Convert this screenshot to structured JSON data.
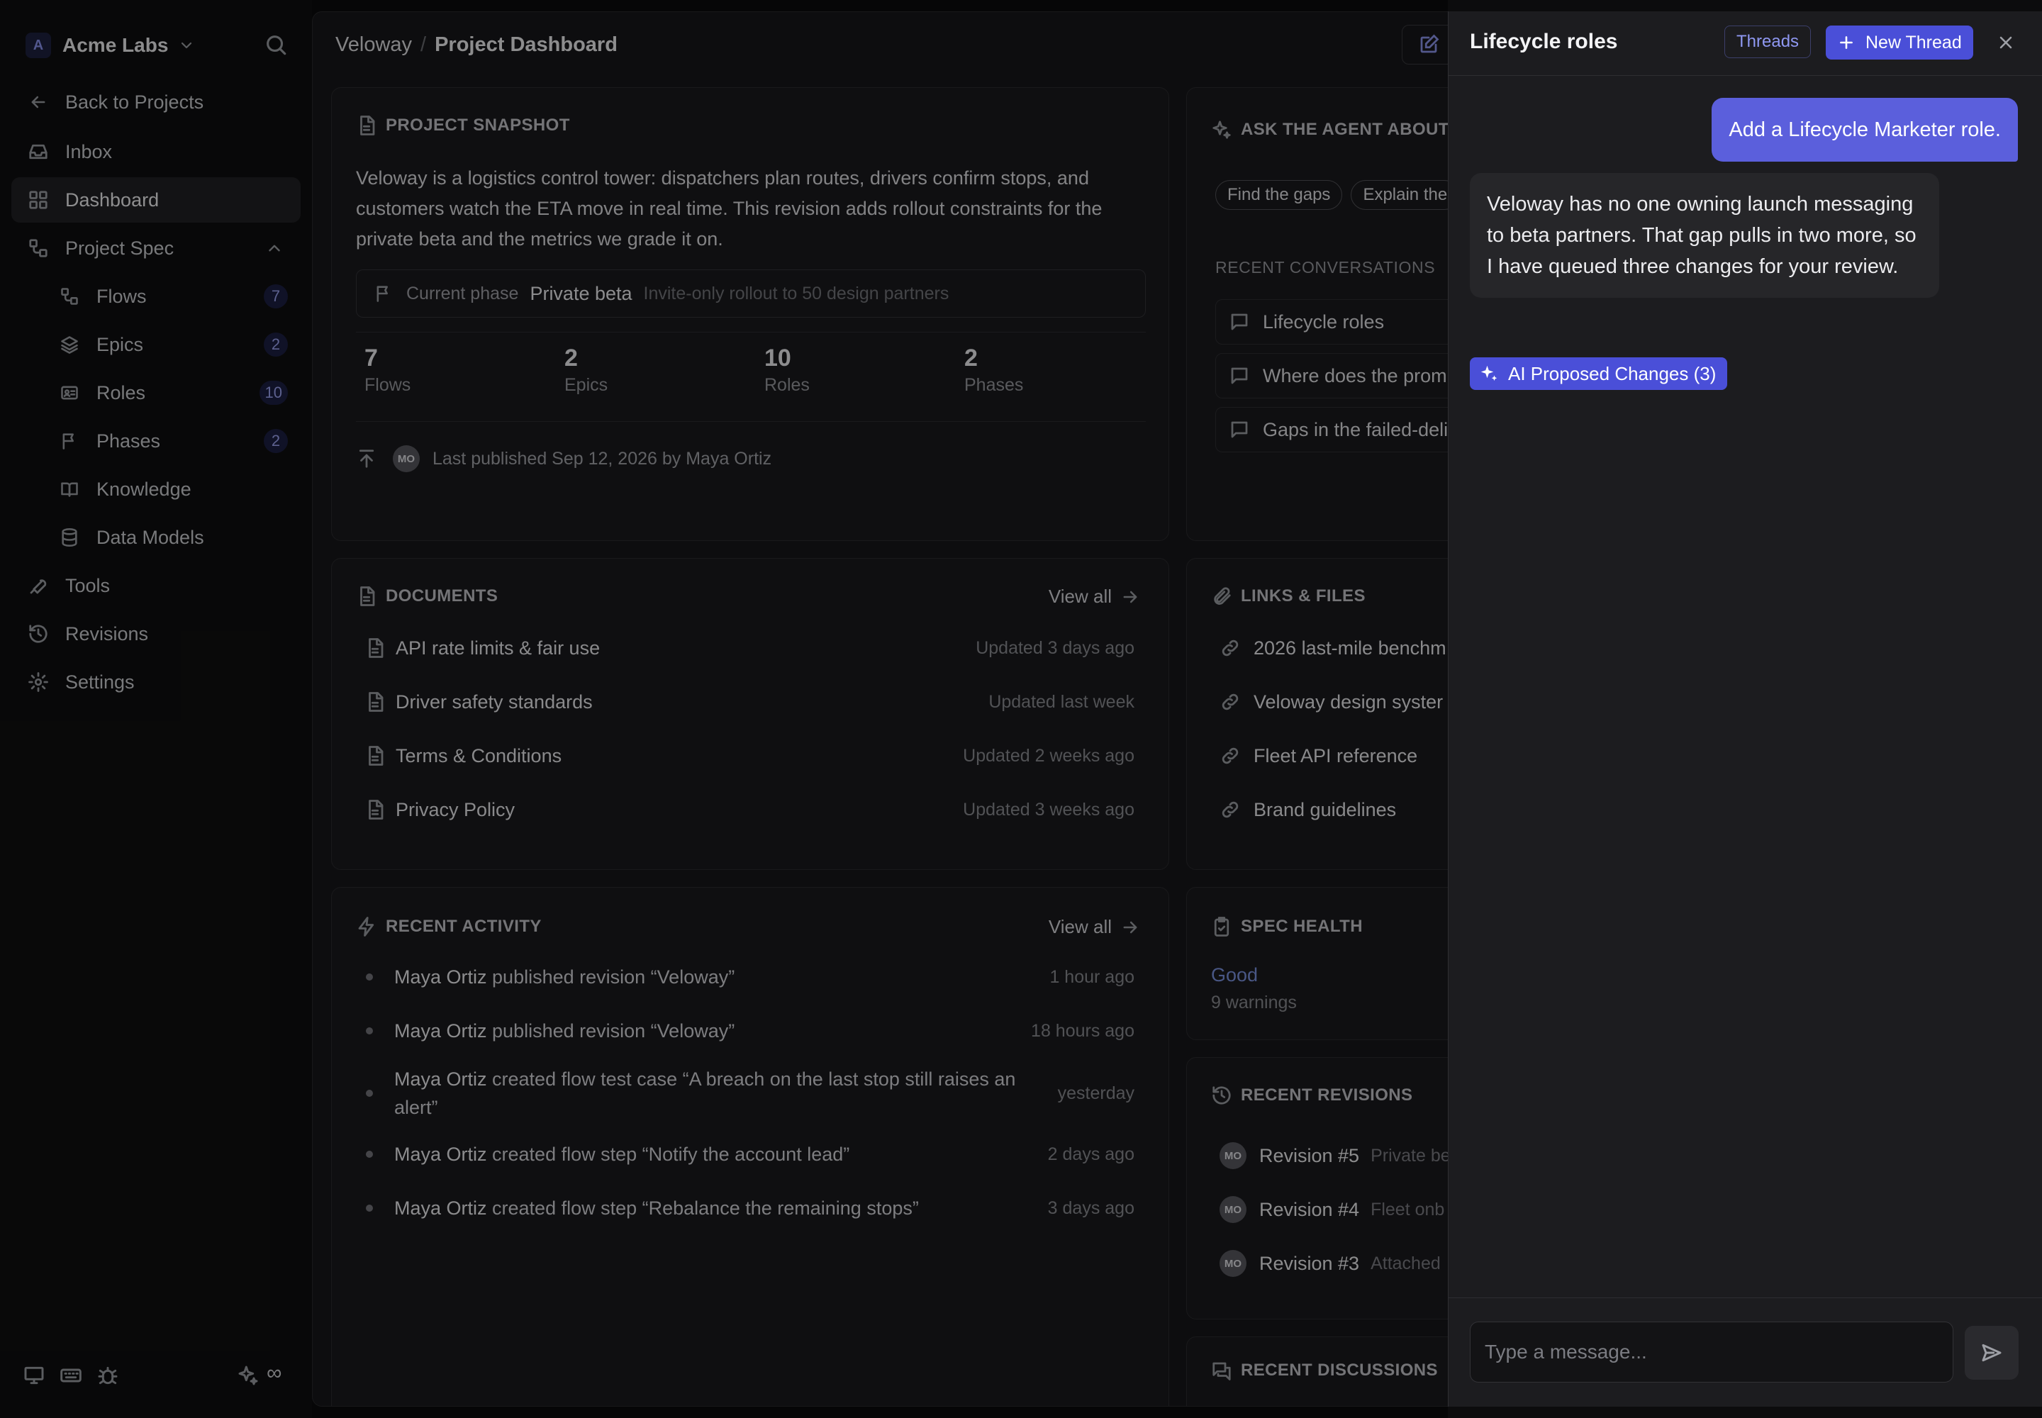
{
  "sidebar": {
    "org_initial": "A",
    "org_name": "Acme Labs",
    "items": [
      {
        "label": "Back to Projects"
      },
      {
        "label": "Inbox"
      },
      {
        "label": "Dashboard"
      },
      {
        "label": "Project Spec"
      },
      {
        "label": "Flows",
        "count": "7"
      },
      {
        "label": "Epics",
        "count": "2"
      },
      {
        "label": "Roles",
        "count": "10"
      },
      {
        "label": "Phases",
        "count": "2"
      },
      {
        "label": "Knowledge"
      },
      {
        "label": "Data Models"
      },
      {
        "label": "Tools"
      },
      {
        "label": "Revisions"
      },
      {
        "label": "Settings"
      }
    ],
    "footer_infinity": "∞"
  },
  "header": {
    "project": "Veloway",
    "separator": "/",
    "page": "Project Dashboard"
  },
  "snapshot": {
    "title": "PROJECT SNAPSHOT",
    "description": "Veloway is a logistics control tower: dispatchers plan routes, drivers confirm stops, and customers watch the ETA move in real time. This revision adds rollout constraints for the private beta and the metrics we grade it on.",
    "phase_label": "Current phase",
    "phase_value": "Private beta",
    "phase_note": "Invite-only rollout to 50 design partners",
    "stats": [
      {
        "value": "7",
        "label": "Flows"
      },
      {
        "value": "2",
        "label": "Epics"
      },
      {
        "value": "10",
        "label": "Roles"
      },
      {
        "value": "2",
        "label": "Phases"
      }
    ],
    "avatar_initials": "MO",
    "published": "Last published Sep 12, 2026 by Maya Ortiz"
  },
  "agent": {
    "title": "ASK THE AGENT ABOUT",
    "chips": [
      "Find the gaps",
      "Explain the"
    ],
    "recent_title": "RECENT CONVERSATIONS",
    "conversations": [
      "Lifecycle roles",
      "Where does the prom",
      "Gaps in the failed-deli"
    ]
  },
  "documents": {
    "title": "DOCUMENTS",
    "view_all": "View all",
    "rows": [
      {
        "name": "API rate limits & fair use",
        "meta": "Updated 3 days ago"
      },
      {
        "name": "Driver safety standards",
        "meta": "Updated last week"
      },
      {
        "name": "Terms & Conditions",
        "meta": "Updated 2 weeks ago"
      },
      {
        "name": "Privacy Policy",
        "meta": "Updated 3 weeks ago"
      }
    ]
  },
  "links": {
    "title": "LINKS & FILES",
    "rows": [
      "2026 last-mile benchm",
      "Veloway design syster",
      "Fleet API reference",
      "Brand guidelines"
    ]
  },
  "activity": {
    "title": "RECENT ACTIVITY",
    "view_all": "View all",
    "rows": [
      {
        "who": "Maya Ortiz",
        "what": " published revision “Veloway”",
        "when": "1 hour ago"
      },
      {
        "who": "Maya Ortiz",
        "what": " published revision “Veloway”",
        "when": "18 hours ago"
      },
      {
        "who": "Maya Ortiz",
        "what": " created flow test case “A breach on the last stop still raises an alert”",
        "when": "yesterday"
      },
      {
        "who": "Maya Ortiz",
        "what": " created flow step “Notify the account lead”",
        "when": "2 days ago"
      },
      {
        "who": "Maya Ortiz",
        "what": " created flow step “Rebalance the remaining stops”",
        "when": "3 days ago"
      }
    ]
  },
  "health": {
    "title": "SPEC HEALTH",
    "status": "Good",
    "warnings": "9 warnings",
    "status_color": "#7f97e6"
  },
  "revisions": {
    "title": "RECENT REVISIONS",
    "rows": [
      {
        "avatar": "MO",
        "name": "Revision #5",
        "desc": "Private be"
      },
      {
        "avatar": "MO",
        "name": "Revision #4",
        "desc": "Fleet onb"
      },
      {
        "avatar": "MO",
        "name": "Revision #3",
        "desc": "Attached"
      }
    ]
  },
  "discussions": {
    "title": "RECENT DISCUSSIONS"
  },
  "panel": {
    "title": "Lifecycle roles",
    "threads_label": "Threads",
    "new_thread_label": "New Thread",
    "user_message": "Add a Lifecycle Marketer role.",
    "agent_message": "Veloway has no one owning launch messaging to beta partners. That gap pulls in two more, so I have queued three changes for your review.",
    "proposed_changes": "AI Proposed Changes (3)",
    "composer_placeholder": "Type a message...",
    "accent": "#4a4fd8"
  }
}
